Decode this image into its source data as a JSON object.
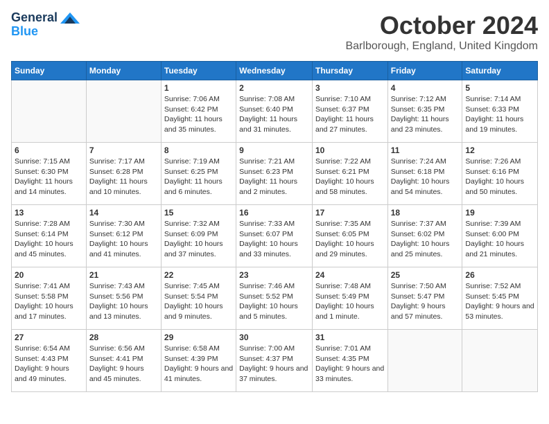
{
  "header": {
    "logo_general": "General",
    "logo_blue": "Blue",
    "month": "October 2024",
    "location": "Barlborough, England, United Kingdom"
  },
  "calendar": {
    "days_of_week": [
      "Sunday",
      "Monday",
      "Tuesday",
      "Wednesday",
      "Thursday",
      "Friday",
      "Saturday"
    ],
    "weeks": [
      [
        {
          "day": "",
          "info": ""
        },
        {
          "day": "",
          "info": ""
        },
        {
          "day": "1",
          "info": "Sunrise: 7:06 AM\nSunset: 6:42 PM\nDaylight: 11 hours and 35 minutes."
        },
        {
          "day": "2",
          "info": "Sunrise: 7:08 AM\nSunset: 6:40 PM\nDaylight: 11 hours and 31 minutes."
        },
        {
          "day": "3",
          "info": "Sunrise: 7:10 AM\nSunset: 6:37 PM\nDaylight: 11 hours and 27 minutes."
        },
        {
          "day": "4",
          "info": "Sunrise: 7:12 AM\nSunset: 6:35 PM\nDaylight: 11 hours and 23 minutes."
        },
        {
          "day": "5",
          "info": "Sunrise: 7:14 AM\nSunset: 6:33 PM\nDaylight: 11 hours and 19 minutes."
        }
      ],
      [
        {
          "day": "6",
          "info": "Sunrise: 7:15 AM\nSunset: 6:30 PM\nDaylight: 11 hours and 14 minutes."
        },
        {
          "day": "7",
          "info": "Sunrise: 7:17 AM\nSunset: 6:28 PM\nDaylight: 11 hours and 10 minutes."
        },
        {
          "day": "8",
          "info": "Sunrise: 7:19 AM\nSunset: 6:25 PM\nDaylight: 11 hours and 6 minutes."
        },
        {
          "day": "9",
          "info": "Sunrise: 7:21 AM\nSunset: 6:23 PM\nDaylight: 11 hours and 2 minutes."
        },
        {
          "day": "10",
          "info": "Sunrise: 7:22 AM\nSunset: 6:21 PM\nDaylight: 10 hours and 58 minutes."
        },
        {
          "day": "11",
          "info": "Sunrise: 7:24 AM\nSunset: 6:18 PM\nDaylight: 10 hours and 54 minutes."
        },
        {
          "day": "12",
          "info": "Sunrise: 7:26 AM\nSunset: 6:16 PM\nDaylight: 10 hours and 50 minutes."
        }
      ],
      [
        {
          "day": "13",
          "info": "Sunrise: 7:28 AM\nSunset: 6:14 PM\nDaylight: 10 hours and 45 minutes."
        },
        {
          "day": "14",
          "info": "Sunrise: 7:30 AM\nSunset: 6:12 PM\nDaylight: 10 hours and 41 minutes."
        },
        {
          "day": "15",
          "info": "Sunrise: 7:32 AM\nSunset: 6:09 PM\nDaylight: 10 hours and 37 minutes."
        },
        {
          "day": "16",
          "info": "Sunrise: 7:33 AM\nSunset: 6:07 PM\nDaylight: 10 hours and 33 minutes."
        },
        {
          "day": "17",
          "info": "Sunrise: 7:35 AM\nSunset: 6:05 PM\nDaylight: 10 hours and 29 minutes."
        },
        {
          "day": "18",
          "info": "Sunrise: 7:37 AM\nSunset: 6:02 PM\nDaylight: 10 hours and 25 minutes."
        },
        {
          "day": "19",
          "info": "Sunrise: 7:39 AM\nSunset: 6:00 PM\nDaylight: 10 hours and 21 minutes."
        }
      ],
      [
        {
          "day": "20",
          "info": "Sunrise: 7:41 AM\nSunset: 5:58 PM\nDaylight: 10 hours and 17 minutes."
        },
        {
          "day": "21",
          "info": "Sunrise: 7:43 AM\nSunset: 5:56 PM\nDaylight: 10 hours and 13 minutes."
        },
        {
          "day": "22",
          "info": "Sunrise: 7:45 AM\nSunset: 5:54 PM\nDaylight: 10 hours and 9 minutes."
        },
        {
          "day": "23",
          "info": "Sunrise: 7:46 AM\nSunset: 5:52 PM\nDaylight: 10 hours and 5 minutes."
        },
        {
          "day": "24",
          "info": "Sunrise: 7:48 AM\nSunset: 5:49 PM\nDaylight: 10 hours and 1 minute."
        },
        {
          "day": "25",
          "info": "Sunrise: 7:50 AM\nSunset: 5:47 PM\nDaylight: 9 hours and 57 minutes."
        },
        {
          "day": "26",
          "info": "Sunrise: 7:52 AM\nSunset: 5:45 PM\nDaylight: 9 hours and 53 minutes."
        }
      ],
      [
        {
          "day": "27",
          "info": "Sunrise: 6:54 AM\nSunset: 4:43 PM\nDaylight: 9 hours and 49 minutes."
        },
        {
          "day": "28",
          "info": "Sunrise: 6:56 AM\nSunset: 4:41 PM\nDaylight: 9 hours and 45 minutes."
        },
        {
          "day": "29",
          "info": "Sunrise: 6:58 AM\nSunset: 4:39 PM\nDaylight: 9 hours and 41 minutes."
        },
        {
          "day": "30",
          "info": "Sunrise: 7:00 AM\nSunset: 4:37 PM\nDaylight: 9 hours and 37 minutes."
        },
        {
          "day": "31",
          "info": "Sunrise: 7:01 AM\nSunset: 4:35 PM\nDaylight: 9 hours and 33 minutes."
        },
        {
          "day": "",
          "info": ""
        },
        {
          "day": "",
          "info": ""
        }
      ]
    ]
  }
}
